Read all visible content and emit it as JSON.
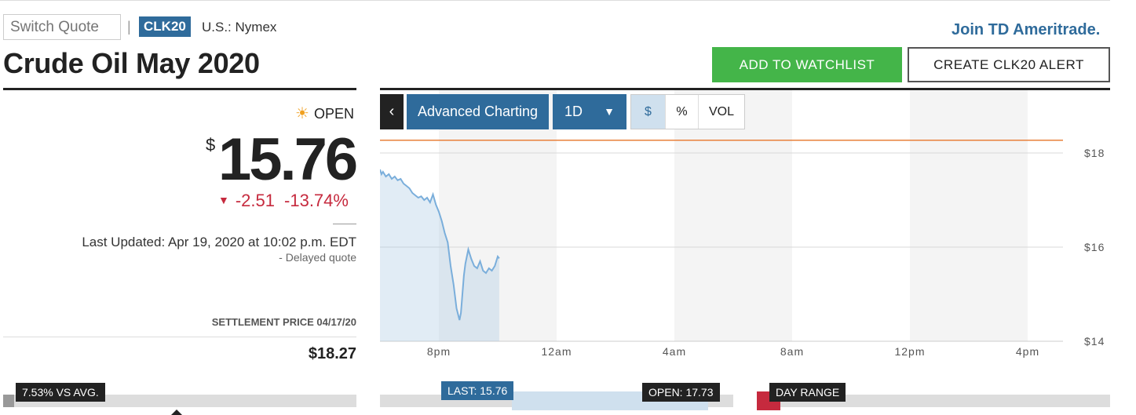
{
  "header": {
    "switch_quote_placeholder": "Switch Quote",
    "separator": "|",
    "ticker": "CLK20",
    "exchange": "U.S.: Nymex",
    "title": "Crude Oil May 2020",
    "join_link": "Join TD Ameritrade.",
    "add_watchlist": "ADD TO WATCHLIST",
    "create_alert": "CREATE CLK20 ALERT"
  },
  "quote": {
    "status": "OPEN",
    "currency_symbol": "$",
    "price": "15.76",
    "change": "-2.51",
    "change_pct": "-13.74%",
    "last_updated": "Last Updated: Apr 19, 2020 at 10:02 p.m. EDT",
    "delayed": "-  Delayed quote",
    "settlement_label": "SETTLEMENT PRICE 04/17/20",
    "settlement_value": "$18.27"
  },
  "toolbar": {
    "back": "‹",
    "advanced": "Advanced Charting",
    "range": "1D",
    "dollar": "$",
    "percent": "%",
    "vol": "VOL"
  },
  "chart_data": {
    "type": "area",
    "x_ticks": [
      "8pm",
      "12am",
      "4am",
      "8am",
      "12pm",
      "4pm"
    ],
    "y_ticks": [
      "$18",
      "$16",
      "$14"
    ],
    "ylim": [
      14,
      18.5
    ],
    "reference_line": 18.27,
    "series": [
      {
        "x_hours": [
          0,
          0.05,
          0.1,
          0.2,
          0.3,
          0.4,
          0.5,
          0.6,
          0.7,
          0.8,
          0.9,
          1.0,
          1.1,
          1.2,
          1.3,
          1.4,
          1.5,
          1.6,
          1.7,
          1.8,
          1.9,
          2.0,
          2.1,
          2.2,
          2.3,
          2.4,
          2.5,
          2.6,
          2.7,
          2.75,
          2.8,
          2.85,
          2.9,
          3.0,
          3.1,
          3.2,
          3.3,
          3.4,
          3.5,
          3.6,
          3.7,
          3.8,
          3.9,
          4.0,
          4.05
        ],
        "values": [
          17.65,
          17.55,
          17.6,
          17.5,
          17.55,
          17.45,
          17.5,
          17.42,
          17.45,
          17.35,
          17.3,
          17.25,
          17.15,
          17.1,
          17.05,
          17.08,
          17.0,
          17.05,
          16.95,
          17.12,
          16.9,
          16.75,
          16.55,
          16.3,
          16.1,
          15.6,
          15.2,
          14.7,
          14.45,
          14.6,
          15.0,
          15.4,
          15.65,
          15.95,
          15.75,
          15.6,
          15.55,
          15.7,
          15.5,
          15.45,
          15.55,
          15.5,
          15.6,
          15.8,
          15.76
        ]
      }
    ]
  },
  "ranges": {
    "vs_avg": "7.53% VS AVG.",
    "last": "LAST: 15.76",
    "open": "OPEN: 17.73",
    "day_range": "DAY RANGE"
  },
  "colors": {
    "accent": "#2f6b9b",
    "green": "#44b549",
    "down": "#c62a3e",
    "line": "#7aaedb",
    "reference": "#e8803a"
  }
}
